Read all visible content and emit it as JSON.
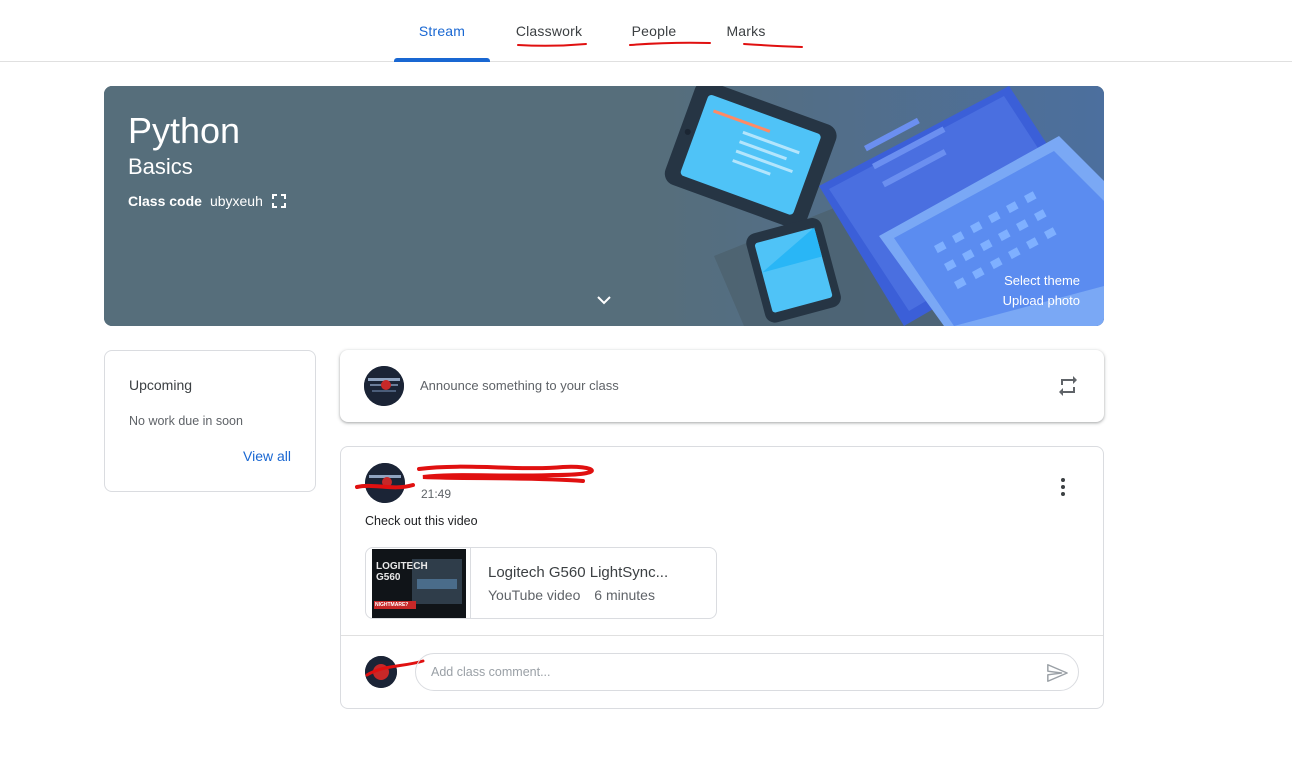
{
  "nav": {
    "tabs": [
      {
        "label": "Stream",
        "active": true
      },
      {
        "label": "Classwork",
        "active": false
      },
      {
        "label": "People",
        "active": false
      },
      {
        "label": "Marks",
        "active": false
      }
    ]
  },
  "banner": {
    "title": "Python",
    "subtitle": "Basics",
    "class_code_label": "Class code",
    "class_code": "ubyxeuh",
    "select_theme": "Select theme",
    "upload_photo": "Upload photo",
    "background_color": "#566e7b"
  },
  "upcoming": {
    "title": "Upcoming",
    "empty_text": "No work due in soon",
    "view_all": "View all"
  },
  "announce": {
    "placeholder": "Announce something to your class"
  },
  "post": {
    "time": "21:49",
    "text": "Check out this video",
    "attachment": {
      "title": "Logitech G560 LightSync...",
      "type": "YouTube video",
      "duration": "6 minutes",
      "thumbnail_text": "LOGITECH G560",
      "thumbnail_badge": "NIGHTMARE?"
    },
    "comment_placeholder": "Add class comment..."
  },
  "colors": {
    "accent": "#1967d2",
    "annotation_red": "#e01010"
  }
}
